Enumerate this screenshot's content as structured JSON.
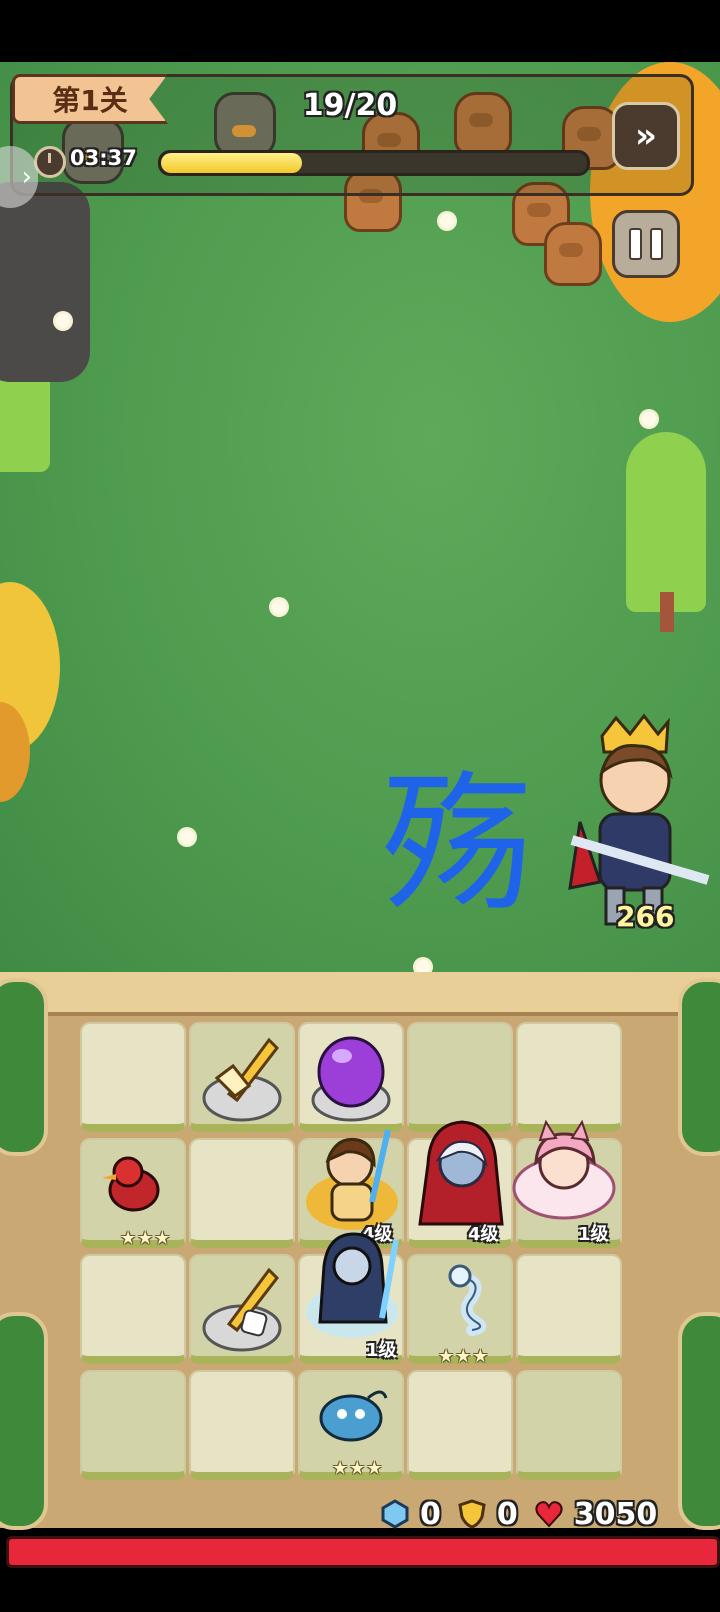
{
  "hud": {
    "level_label": "第1关",
    "wave_progress": "19/20",
    "timer": "03:37",
    "progress_fraction": 0.33,
    "skip_icon": "fast-forward-icon",
    "pause_icon": "pause-icon"
  },
  "field": {
    "watermark_char": "殇",
    "hero_hp": "266"
  },
  "board": {
    "units": [
      {
        "name": "golden-sword-item",
        "row": 0,
        "col": 1
      },
      {
        "name": "purple-gem-item",
        "row": 0,
        "col": 2
      },
      {
        "name": "red-bird-unit",
        "row": 1,
        "col": 0,
        "stars": "★★★"
      },
      {
        "name": "fire-warrior-hero",
        "row": 1,
        "col": 2,
        "level": "4级"
      },
      {
        "name": "red-hood-hero",
        "row": 1,
        "col": 3,
        "level": "4级"
      },
      {
        "name": "fox-girl-hero",
        "row": 1,
        "col": 4,
        "level": "1级"
      },
      {
        "name": "golden-sword-dice-item",
        "row": 2,
        "col": 1
      },
      {
        "name": "ice-knight-hero",
        "row": 2,
        "col": 2,
        "level": "1级"
      },
      {
        "name": "white-serpent-unit",
        "row": 2,
        "col": 3,
        "stars": "★★★"
      },
      {
        "name": "blue-sprite-unit",
        "row": 3,
        "col": 2,
        "stars": "★★★"
      }
    ]
  },
  "resources": {
    "crystal": "0",
    "shield": "0",
    "hp": "3050"
  },
  "colors": {
    "grass": "#4e9b4f",
    "board": "#c9a873",
    "hp_bar": "#e8283a",
    "watermark": "#1f64e8"
  }
}
